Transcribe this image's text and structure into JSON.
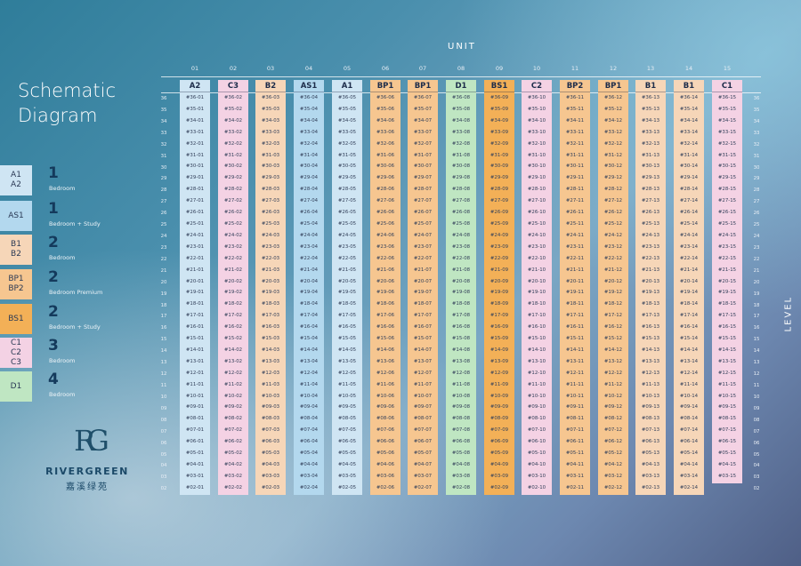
{
  "title_line1": "Schematic",
  "title_line2": "Diagram",
  "unit_label": "UNIT",
  "level_label": "LEVEL",
  "logo": {
    "name": "RIVERGREEN",
    "chinese": "嘉溪绿苑",
    "mark": "RG"
  },
  "colors": {
    "A": "#cfe5f3",
    "B": "#f6d6b8",
    "BP": "#f6c690",
    "BS": "#f3b057",
    "C": "#f4d2e4",
    "D": "#bfe6c2"
  },
  "legend": [
    {
      "types": [
        "A1",
        "A2"
      ],
      "num": "1",
      "desc": "Bedroom",
      "color": "#cfe5f3"
    },
    {
      "types": [
        "AS1"
      ],
      "num": "1",
      "desc": "Bedroom + Study",
      "color": "#b3d8ee"
    },
    {
      "types": [
        "B1",
        "B2"
      ],
      "num": "2",
      "desc": "Bedroom",
      "color": "#f6d6b8"
    },
    {
      "types": [
        "BP1",
        "BP2"
      ],
      "num": "2",
      "desc": "Bedroom Premium",
      "color": "#f6c690"
    },
    {
      "types": [
        "BS1"
      ],
      "num": "2",
      "desc": "Bedroom + Study",
      "color": "#f3b057"
    },
    {
      "types": [
        "C1",
        "C2",
        "C3"
      ],
      "num": "3",
      "desc": "Bedroom",
      "color": "#f4d2e4"
    },
    {
      "types": [
        "D1"
      ],
      "num": "4",
      "desc": "Bedroom",
      "color": "#bfe6c2"
    }
  ],
  "columns": [
    {
      "num": "01",
      "type": "A2",
      "color": "#cfe5f3"
    },
    {
      "num": "02",
      "type": "C3",
      "color": "#f4d2e4"
    },
    {
      "num": "03",
      "type": "B2",
      "color": "#f6d6b8"
    },
    {
      "num": "04",
      "type": "AS1",
      "color": "#b3d8ee"
    },
    {
      "num": "05",
      "type": "A1",
      "color": "#cfe5f3"
    },
    {
      "num": "06",
      "type": "BP1",
      "color": "#f6c690"
    },
    {
      "num": "07",
      "type": "BP1",
      "color": "#f6c690"
    },
    {
      "num": "08",
      "type": "D1",
      "color": "#bfe6c2"
    },
    {
      "num": "09",
      "type": "BS1",
      "color": "#f3b057"
    },
    {
      "num": "10",
      "type": "C2",
      "color": "#f4d2e4"
    },
    {
      "num": "11",
      "type": "BP2",
      "color": "#f6c690"
    },
    {
      "num": "12",
      "type": "BP1",
      "color": "#f6c690"
    },
    {
      "num": "13",
      "type": "B1",
      "color": "#f6d6b8"
    },
    {
      "num": "14",
      "type": "B1",
      "color": "#f6d6b8"
    },
    {
      "num": "15",
      "type": "C1",
      "color": "#f4d2e4"
    }
  ],
  "levels_left": [
    "36",
    "35",
    "34",
    "33",
    "32",
    "31",
    "30",
    "29",
    "28",
    "27",
    "26",
    "25",
    "24",
    "23",
    "22",
    "21",
    "20",
    "19",
    "18",
    "17",
    "16",
    "15",
    "14",
    "13",
    "12",
    "11",
    "10",
    "09",
    "08",
    "07",
    "06",
    "05",
    "04",
    "03",
    "02"
  ],
  "levels_right": [
    "36",
    "35",
    "34",
    "33",
    "32",
    "31",
    "30",
    "29",
    "28",
    "27",
    "26",
    "25",
    "24",
    "23",
    "22",
    "21",
    "20",
    "19",
    "18",
    "17",
    "16",
    "15",
    "14",
    "13",
    "12",
    "11",
    "10",
    "09",
    "08",
    "07",
    "06",
    "05",
    "04",
    "03",
    "02"
  ],
  "rows": {
    "36": [
      "#36-01",
      "#36-02",
      "#36-03",
      "#36-04",
      "#36-05",
      "#36-06",
      "#36-07",
      "#36-08",
      "#36-09",
      "#36-10",
      "#36-11",
      "#36-12",
      "#36-13",
      "#36-14",
      "#36-15"
    ],
    "35": [
      "#35-01",
      "#35-02",
      "#35-03",
      "#35-04",
      "#35-05",
      "#35-06",
      "#35-07",
      "#35-08",
      "#35-09",
      "#35-10",
      "#35-11",
      "#35-12",
      "#35-13",
      "#35-14",
      "#35-15"
    ],
    "34": [
      "#34-01",
      "#34-02",
      "#34-03",
      "#34-04",
      "#34-05",
      "#34-06",
      "#34-07",
      "#34-08",
      "#34-09",
      "#34-10",
      "#34-11",
      "#34-12",
      "#34-13",
      "#34-14",
      "#34-15"
    ],
    "33": [
      "#33-01",
      "#33-02",
      "#33-03",
      "#33-04",
      "#33-05",
      "#33-06",
      "#33-07",
      "#33-08",
      "#33-09",
      "#33-10",
      "#33-11",
      "#33-12",
      "#33-13",
      "#33-14",
      "#33-15"
    ],
    "32": [
      "#32-01",
      "#32-02",
      "#32-03",
      "#32-04",
      "#32-05",
      "#32-06",
      "#32-07",
      "#32-08",
      "#32-09",
      "#32-10",
      "#32-11",
      "#32-12",
      "#32-13",
      "#32-14",
      "#32-15"
    ],
    "31": [
      "#31-01",
      "#31-02",
      "#31-03",
      "#31-04",
      "#31-05",
      "#31-06",
      "#31-07",
      "#31-08",
      "#31-09",
      "#31-10",
      "#31-11",
      "#31-12",
      "#31-13",
      "#31-14",
      "#31-15"
    ],
    "30": [
      "#30-01",
      "#30-02",
      "#30-03",
      "#30-04",
      "#30-05",
      "#30-06",
      "#30-07",
      "#30-08",
      "#30-09",
      "#30-10",
      "#30-11",
      "#30-12",
      "#30-13",
      "#30-14",
      "#30-15"
    ],
    "29": [
      "#29-01",
      "#29-02",
      "#29-03",
      "#29-04",
      "#29-05",
      "#29-06",
      "#29-07",
      "#29-08",
      "#29-09",
      "#29-10",
      "#29-11",
      "#29-12",
      "#29-13",
      "#29-14",
      "#29-15"
    ],
    "28": [
      "#28-01",
      "#28-02",
      "#28-03",
      "#28-04",
      "#28-05",
      "#28-06",
      "#28-07",
      "#28-08",
      "#28-09",
      "#28-10",
      "#28-11",
      "#28-12",
      "#28-13",
      "#28-14",
      "#28-15"
    ],
    "27": [
      "#27-01",
      "#27-02",
      "#27-03",
      "#27-04",
      "#27-05",
      "#27-06",
      "#27-07",
      "#27-08",
      "#27-09",
      "#27-10",
      "#27-11",
      "#27-12",
      "#27-13",
      "#27-14",
      "#27-15"
    ],
    "26": [
      "#26-01",
      "#26-02",
      "#26-03",
      "#26-04",
      "#26-05",
      "#26-06",
      "#26-07",
      "#26-08",
      "#26-09",
      "#26-10",
      "#26-11",
      "#26-12",
      "#26-13",
      "#26-14",
      "#26-15"
    ],
    "25": [
      "#25-01",
      "#25-02",
      "#25-03",
      "#25-04",
      "#25-05",
      "#25-06",
      "#25-07",
      "#25-08",
      "#25-09",
      "#25-10",
      "#25-11",
      "#25-12",
      "#25-13",
      "#25-14",
      "#25-15"
    ],
    "24": [
      "#24-01",
      "#24-02",
      "#24-03",
      "#24-04",
      "#24-05",
      "#24-06",
      "#24-07",
      "#24-08",
      "#24-09",
      "#24-10",
      "#24-11",
      "#24-12",
      "#24-13",
      "#24-14",
      "#24-15"
    ],
    "23": [
      "#23-01",
      "#23-02",
      "#23-03",
      "#23-04",
      "#23-05",
      "#23-06",
      "#23-07",
      "#23-08",
      "#23-09",
      "#23-10",
      "#23-11",
      "#23-12",
      "#23-13",
      "#23-14",
      "#23-15"
    ],
    "22": [
      "#22-01",
      "#22-02",
      "#22-03",
      "#22-04",
      "#22-05",
      "#22-06",
      "#22-07",
      "#22-08",
      "#22-09",
      "#22-10",
      "#22-11",
      "#22-12",
      "#22-13",
      "#22-14",
      "#22-15"
    ],
    "21": [
      "#21-01",
      "#21-02",
      "#21-03",
      "#21-04",
      "#21-05",
      "#21-06",
      "#21-07",
      "#21-08",
      "#21-09",
      "#21-10",
      "#21-11",
      "#21-12",
      "#21-13",
      "#21-14",
      "#21-15"
    ],
    "20": [
      "#20-01",
      "#20-02",
      "#20-03",
      "#20-04",
      "#20-05",
      "#20-06",
      "#20-07",
      "#20-08",
      "#20-09",
      "#20-10",
      "#20-11",
      "#20-12",
      "#20-13",
      "#20-14",
      "#20-15"
    ],
    "19": [
      "#19-01",
      "#19-02",
      "#19-03",
      "#19-04",
      "#19-05",
      "#19-06",
      "#19-07",
      "#19-08",
      "#19-09",
      "#19-10",
      "#19-11",
      "#19-12",
      "#19-13",
      "#19-14",
      "#19-15"
    ],
    "18": [
      "#18-01",
      "#18-02",
      "#18-03",
      "#18-04",
      "#18-05",
      "#18-06",
      "#18-07",
      "#18-08",
      "#18-09",
      "#18-10",
      "#18-11",
      "#18-12",
      "#18-13",
      "#18-14",
      "#18-15"
    ],
    "17": [
      "#17-01",
      "#17-02",
      "#17-03",
      "#17-04",
      "#17-05",
      "#17-06",
      "#17-07",
      "#17-08",
      "#17-09",
      "#17-10",
      "#17-11",
      "#17-12",
      "#17-13",
      "#17-14",
      "#17-15"
    ],
    "16": [
      "#16-01",
      "#16-02",
      "#16-03",
      "#16-04",
      "#16-05",
      "#16-06",
      "#16-07",
      "#16-08",
      "#16-09",
      "#16-10",
      "#16-11",
      "#16-12",
      "#16-13",
      "#16-14",
      "#16-15"
    ],
    "15": [
      "#15-01",
      "#15-02",
      "#15-03",
      "#15-04",
      "#15-05",
      "#15-06",
      "#15-07",
      "#15-08",
      "#15-09",
      "#15-10",
      "#15-11",
      "#15-12",
      "#15-13",
      "#15-14",
      "#15-15"
    ],
    "14": [
      "#14-01",
      "#14-02",
      "#14-03",
      "#14-04",
      "#14-05",
      "#14-06",
      "#14-07",
      "#14-08",
      "#14-09",
      "#14-10",
      "#14-11",
      "#14-12",
      "#14-13",
      "#14-14",
      "#14-15"
    ],
    "13": [
      "#13-01",
      "#13-02",
      "#13-03",
      "#13-04",
      "#13-05",
      "#13-06",
      "#13-07",
      "#13-08",
      "#13-09",
      "#13-10",
      "#13-11",
      "#13-12",
      "#13-13",
      "#13-14",
      "#13-15"
    ],
    "12": [
      "#12-01",
      "#12-02",
      "#12-03",
      "#12-04",
      "#12-05",
      "#12-06",
      "#12-07",
      "#12-08",
      "#12-09",
      "#12-10",
      "#12-11",
      "#12-12",
      "#12-13",
      "#12-14",
      "#12-15"
    ],
    "11": [
      "#11-01",
      "#11-02",
      "#11-03",
      "#11-04",
      "#11-05",
      "#11-06",
      "#11-07",
      "#11-08",
      "#11-09",
      "#11-10",
      "#11-11",
      "#11-12",
      "#11-13",
      "#11-14",
      "#11-15"
    ],
    "10": [
      "#10-01",
      "#10-02",
      "#10-03",
      "#10-04",
      "#10-05",
      "#10-06",
      "#10-07",
      "#10-08",
      "#10-09",
      "#10-10",
      "#10-11",
      "#10-12",
      "#10-13",
      "#10-14",
      "#10-15"
    ],
    "09": [
      "#09-01",
      "#09-02",
      "#09-03",
      "#09-04",
      "#09-05",
      "#09-06",
      "#09-07",
      "#09-08",
      "#09-09",
      "#09-10",
      "#09-11",
      "#09-12",
      "#09-13",
      "#09-14",
      "#09-15"
    ],
    "08": [
      "#08-01",
      "#08-02",
      "#08-03",
      "#08-04",
      "#08-05",
      "#08-06",
      "#08-07",
      "#08-08",
      "#08-09",
      "#08-10",
      "#08-11",
      "#08-12",
      "#08-13",
      "#08-14",
      "#08-15"
    ],
    "07": [
      "#07-01",
      "#07-02",
      "#07-03",
      "#07-04",
      "#07-05",
      "#07-06",
      "#07-07",
      "#07-08",
      "#07-09",
      "#07-10",
      "#07-11",
      "#07-12",
      "#07-13",
      "#07-14",
      "#07-15"
    ],
    "06": [
      "#06-01",
      "#06-02",
      "#06-03",
      "#06-04",
      "#06-05",
      "#06-06",
      "#06-07",
      "#06-08",
      "#06-09",
      "#06-10",
      "#06-11",
      "#06-12",
      "#06-13",
      "#06-14",
      "#06-15"
    ],
    "05": [
      "#05-01",
      "#05-02",
      "#05-03",
      "#05-04",
      "#05-05",
      "#05-06",
      "#05-07",
      "#05-08",
      "#05-09",
      "#05-10",
      "#05-11",
      "#05-12",
      "#05-13",
      "#05-14",
      "#05-15"
    ],
    "04": [
      "#04-01",
      "#04-02",
      "#04-03",
      "#04-04",
      "#04-05",
      "#04-06",
      "#04-07",
      "#04-08",
      "#04-09",
      "#04-10",
      "#04-11",
      "#04-12",
      "#04-13",
      "#04-14",
      "#04-15"
    ],
    "03": [
      "#03-01",
      "#03-02",
      "#03-03",
      "#03-04",
      "#03-05",
      "#03-06",
      "#03-07",
      "#03-08",
      "#03-09",
      "#03-10",
      "#03-11",
      "#03-12",
      "#03-13",
      "#03-14",
      "#03-15"
    ],
    "02": [
      "#02-01",
      "#02-02",
      "#02-03",
      "#02-04",
      "#02-05",
      "#02-06",
      "#02-07",
      "#02-08",
      "#02-09",
      "#02-10",
      "#02-11",
      "#02-12",
      "#02-13",
      "#02-14",
      ""
    ]
  }
}
